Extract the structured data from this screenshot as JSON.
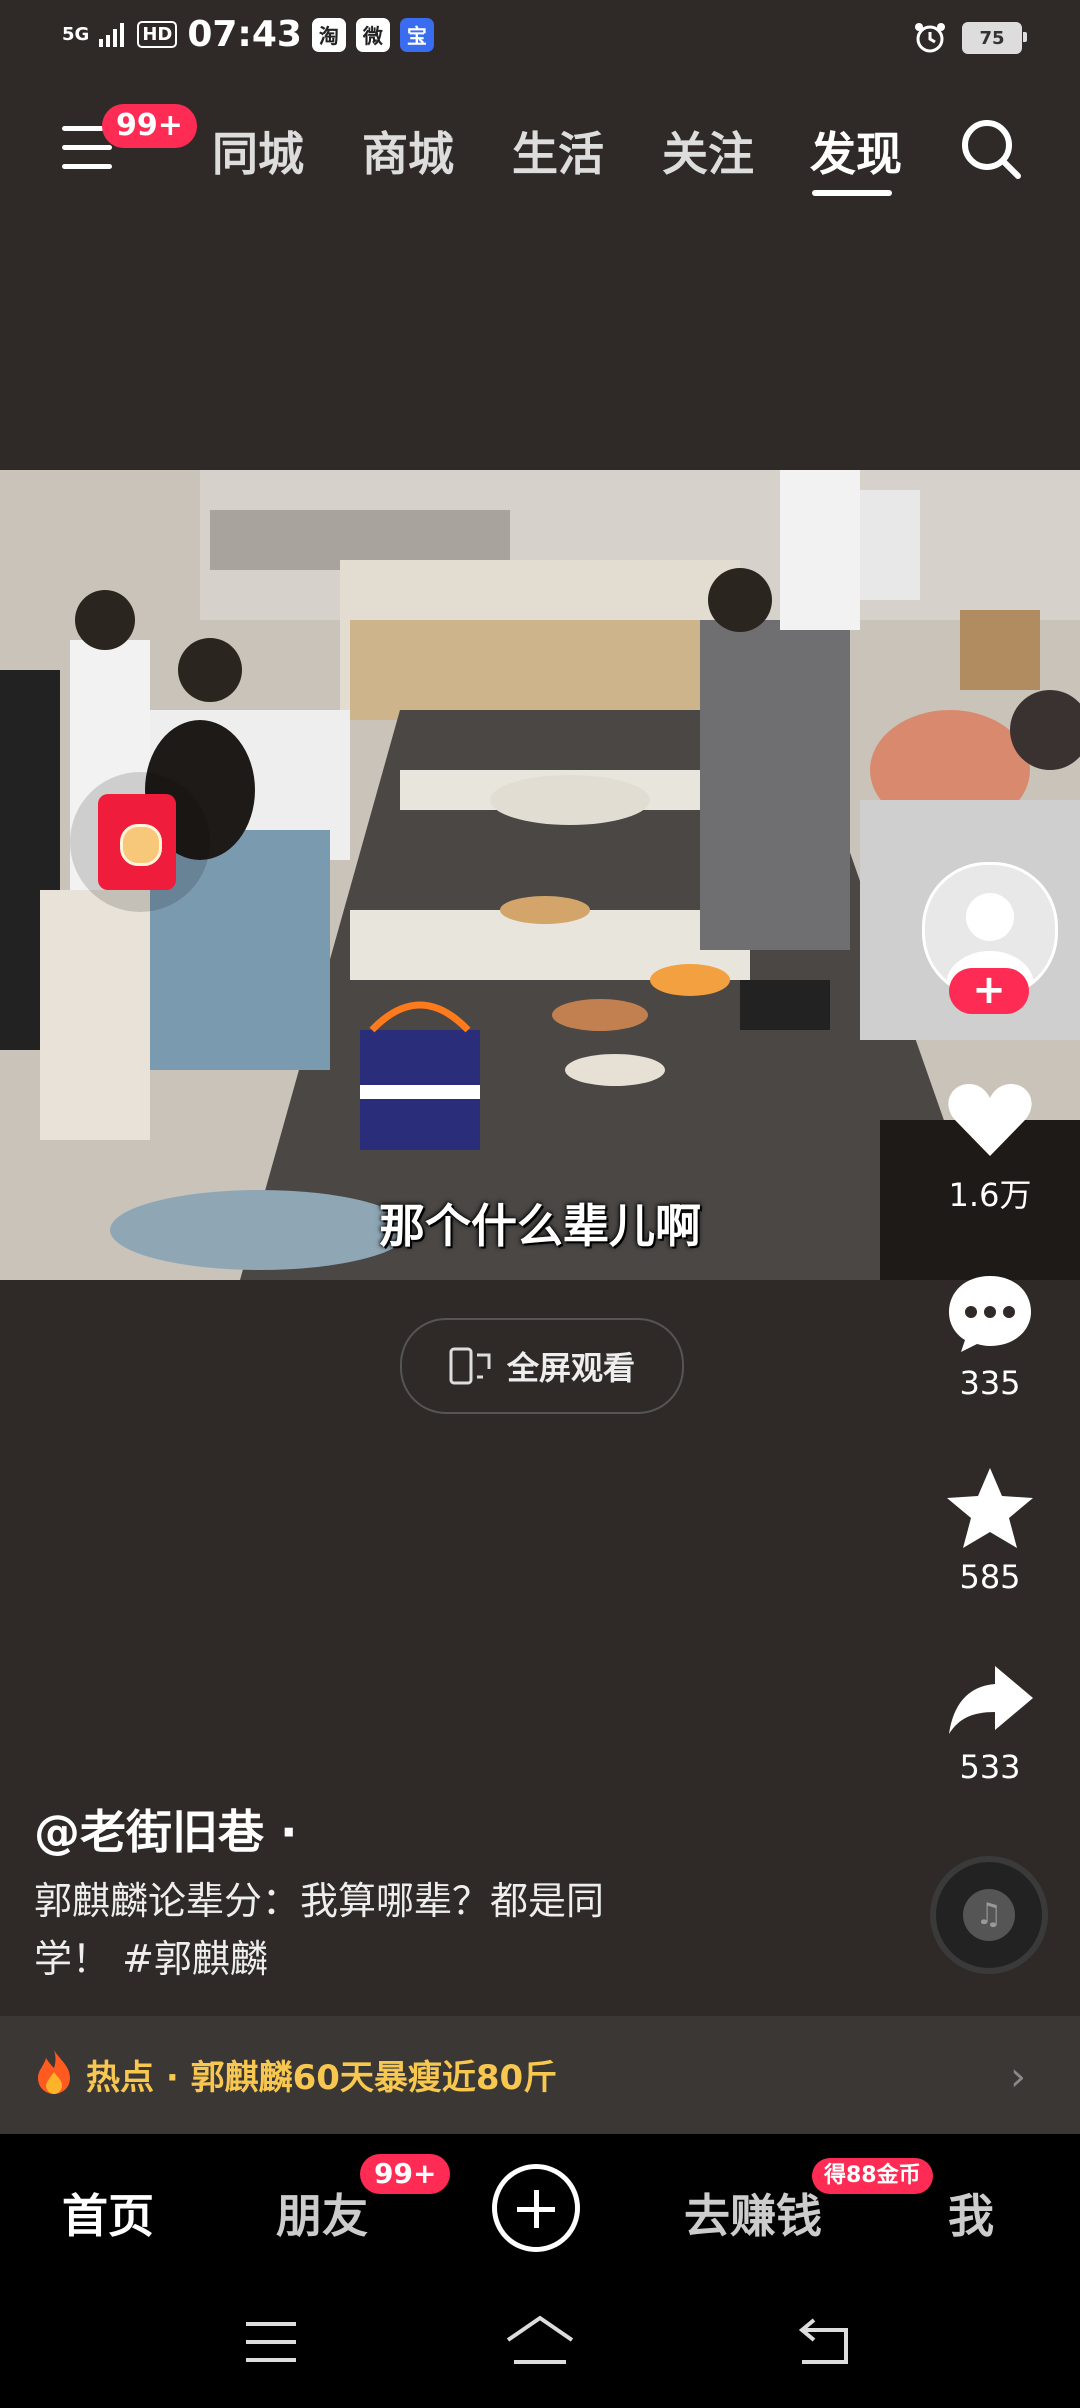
{
  "status_bar": {
    "network": "5G",
    "hd": "HD",
    "time": "07:43",
    "apps": [
      "淘",
      "微",
      "宝"
    ],
    "battery": "75"
  },
  "top_nav": {
    "menu_badge": "99+",
    "tabs": [
      "同城",
      "商城",
      "生活",
      "关注",
      "发现"
    ],
    "active_tab": "发现"
  },
  "video": {
    "subtitle": "那个什么辈儿啊",
    "fullscreen_label": "全屏观看"
  },
  "actions": {
    "likes": "1.6万",
    "comments": "335",
    "favorites": "585",
    "shares": "533"
  },
  "post": {
    "author": "@老街旧巷 ·",
    "description_line1": "郭麒麟论辈分：我算哪辈？都是同",
    "description_line2": "学！ #郭麒麟"
  },
  "hot": {
    "label": "热点 · 郭麒麟60天暴瘦近80斤"
  },
  "bottom_nav": {
    "home": "首页",
    "friends": "朋友",
    "friends_badge": "99+",
    "earn": "去赚钱",
    "earn_badge": "得88金币",
    "me": "我"
  },
  "colors": {
    "accent": "#fe2c55",
    "hot_text": "#f7c750",
    "background": "#2f2a27"
  }
}
